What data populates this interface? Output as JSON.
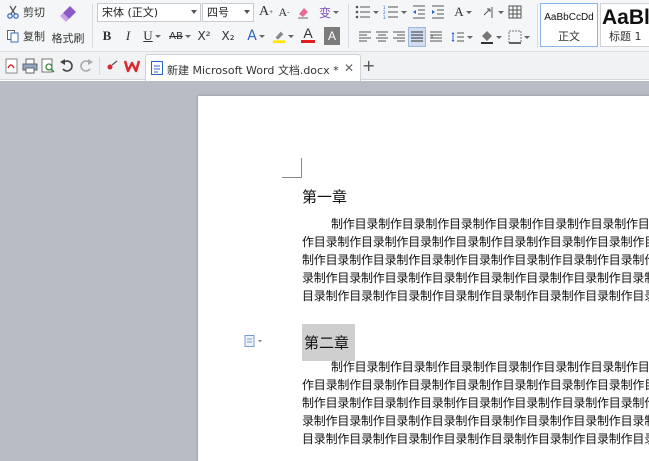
{
  "ribbon": {
    "cut_label": "剪切",
    "copy_label": "复制",
    "painter_label": "格式刷",
    "font_name": "宋体 (正文)",
    "font_size": "四号",
    "styles": [
      {
        "sample": "AaBbCcDd",
        "caption": "正文"
      },
      {
        "sample": "AaBl",
        "caption": "标题 1"
      }
    ],
    "bold": "B",
    "italic": "I",
    "underline": "U",
    "strike": "AB",
    "superscript": "X²",
    "subscript": "X₂",
    "text_effect": "A",
    "font_color": "A",
    "char_shading": "A",
    "grow_font": "A",
    "shrink_font": "A",
    "phonetic": "变"
  },
  "tabbar": {
    "doc_title": "新建 Microsoft Word 文档.docx *",
    "close": "✕",
    "new_tab": "+"
  },
  "document": {
    "heading1": "第一章",
    "para1": [
      "制作目录制作目录制作目录制作目录制作目录制作目录制作目录制作",
      "作目录制作目录制作目录制作目录制作目录制作目录制作目录制作目录制",
      "制作目录制作目录制作目录制作目录制作目录制作目录制作目录制作目录",
      "录制作目录制作目录制作目录制作目录制作目录制作目录制作目录制作目",
      "目录制作目录制作目录制作目录制作目录制作目录制作目录制作目录制作"
    ],
    "heading2": "第二章",
    "para2": [
      "制作目录制作目录制作目录制作目录制作目录制作目录制作目录制作",
      "作目录制作目录制作目录制作目录制作目录制作目录制作目录制作目录制",
      "制作目录制作目录制作目录制作目录制作目录制作目录制作目录制作目录",
      "录制作目录制作目录制作目录制作目录制作目录制作目录制作目录制作目",
      "目录制作目录制作目录制作目录制作目录制作目录制作目录制作目录制作"
    ]
  },
  "colors": {
    "highlight_yellow": "#ffe600",
    "font_color_red": "#e02020",
    "wps_red": "#d9262c",
    "accent_blue": "#2a62c9",
    "canvas_gray": "#b8bcc5"
  }
}
